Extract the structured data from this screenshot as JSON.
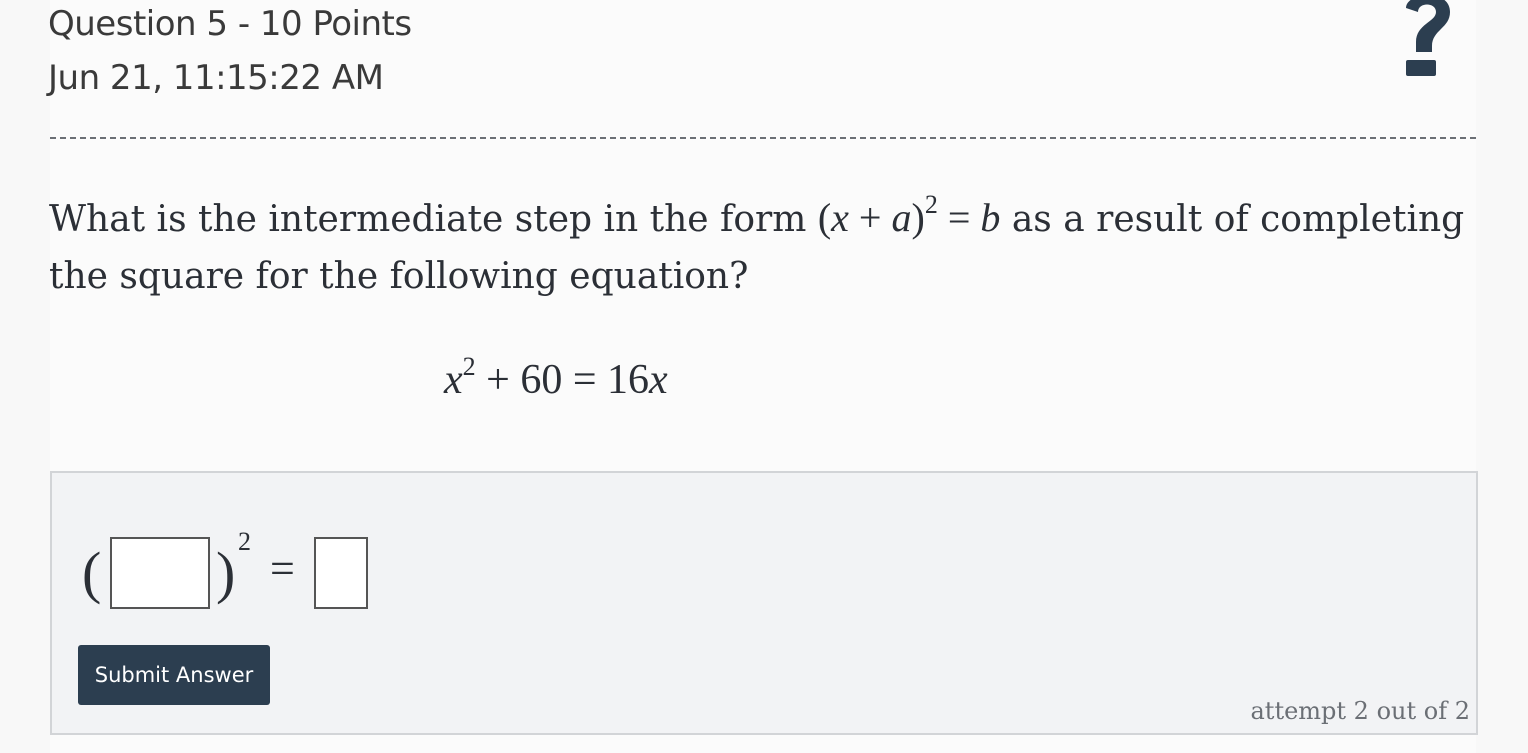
{
  "header": {
    "question_label": "Question 5 - 10 Points",
    "timestamp": "Jun 21, 11:15:22 AM",
    "help_icon": "question-mark-icon"
  },
  "question": {
    "text_before": "What is the intermediate step in the form ",
    "form_open": "(",
    "form_x": "x",
    "form_plus": " + ",
    "form_a": "a",
    "form_close": ")",
    "form_exp": "2",
    "form_eq": " = ",
    "form_b": "b",
    "text_after": " as a result of completing the square for the following equation?"
  },
  "equation": {
    "x": "x",
    "exp": "2",
    "rest": " + 60 = 16",
    "x2": "x"
  },
  "answer": {
    "open_paren": "(",
    "close_paren": ")",
    "exponent": "2",
    "equals": "=",
    "input_a_value": "",
    "input_b_value": "",
    "submit_label": "Submit Answer",
    "attempt_text": "attempt 2 out of 2"
  },
  "colors": {
    "button_bg": "#2c3e50",
    "text": "#2b2f36",
    "answer_bg": "#f2f3f5"
  }
}
